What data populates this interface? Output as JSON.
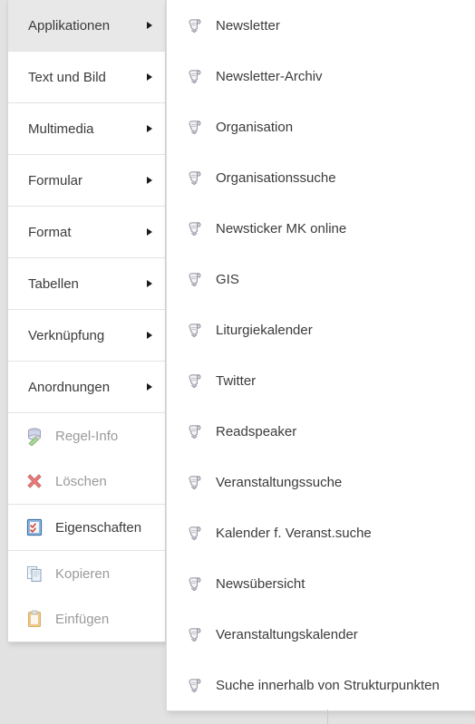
{
  "theme": {
    "page_background": "#e2e2e2",
    "panel_background": "#ffffff",
    "highlight_background": "#e8e8e8",
    "text_color": "#3b3b3b",
    "disabled_text_color": "#9a9a9a",
    "separator_color": "#e3e3e3"
  },
  "context_menu": {
    "name": "Kontextmenü",
    "categories": [
      {
        "label": "Applikationen",
        "has_submenu": true,
        "highlighted": true
      },
      {
        "label": "Text und Bild",
        "has_submenu": true,
        "highlighted": false
      },
      {
        "label": "Multimedia",
        "has_submenu": true,
        "highlighted": false
      },
      {
        "label": "Formular",
        "has_submenu": true,
        "highlighted": false
      },
      {
        "label": "Format",
        "has_submenu": true,
        "highlighted": false
      },
      {
        "label": "Tabellen",
        "has_submenu": true,
        "highlighted": false
      },
      {
        "label": "Verknüpfung",
        "has_submenu": true,
        "highlighted": false
      },
      {
        "label": "Anordnungen",
        "has_submenu": true,
        "highlighted": false
      }
    ],
    "actions": [
      {
        "label": "Regel-Info",
        "icon": "database-rule-icon",
        "enabled": false
      },
      {
        "label": "Löschen",
        "icon": "red-x-delete-icon",
        "enabled": false
      },
      {
        "label": "Eigenschaften",
        "icon": "properties-checklist-icon",
        "enabled": true
      },
      {
        "label": "Kopieren",
        "icon": "copy-pages-icon",
        "enabled": false
      },
      {
        "label": "Einfügen",
        "icon": "paste-clipboard-icon",
        "enabled": false
      }
    ]
  },
  "submenu": {
    "name": "Applikationen",
    "item_icon": "plugin-scroll-icon",
    "items": [
      {
        "label": "Newsletter"
      },
      {
        "label": "Newsletter-Archiv"
      },
      {
        "label": "Organisation"
      },
      {
        "label": "Organisationssuche"
      },
      {
        "label": "Newsticker MK online"
      },
      {
        "label": "GIS"
      },
      {
        "label": "Liturgiekalender"
      },
      {
        "label": "Twitter"
      },
      {
        "label": "Readspeaker"
      },
      {
        "label": "Veranstaltungssuche"
      },
      {
        "label": "Kalender f. Veranst.suche"
      },
      {
        "label": "Newsübersicht"
      },
      {
        "label": "Veranstaltungskalender"
      },
      {
        "label": "Suche innerhalb von Strukturpunkten"
      }
    ]
  }
}
